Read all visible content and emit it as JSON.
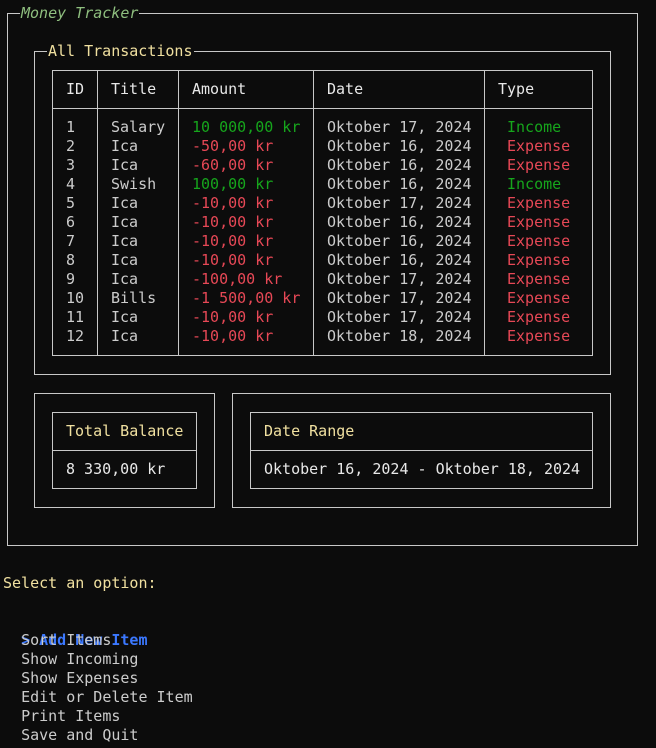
{
  "app": {
    "title": "Money Tracker"
  },
  "transactions": {
    "legend": "All Transactions",
    "columns": [
      "ID",
      "Title",
      "Amount",
      "Date",
      "Type"
    ],
    "rows": [
      {
        "id": "1",
        "title": "Salary",
        "amount": "10 000,00 kr",
        "date": "Oktober 17, 2024",
        "type": "Income"
      },
      {
        "id": "2",
        "title": "Ica",
        "amount": "-50,00 kr",
        "date": "Oktober 16, 2024",
        "type": "Expense"
      },
      {
        "id": "3",
        "title": "Ica",
        "amount": "-60,00 kr",
        "date": "Oktober 16, 2024",
        "type": "Expense"
      },
      {
        "id": "4",
        "title": "Swish",
        "amount": "100,00 kr",
        "date": "Oktober 16, 2024",
        "type": "Income"
      },
      {
        "id": "5",
        "title": "Ica",
        "amount": "-10,00 kr",
        "date": "Oktober 17, 2024",
        "type": "Expense"
      },
      {
        "id": "6",
        "title": "Ica",
        "amount": "-10,00 kr",
        "date": "Oktober 16, 2024",
        "type": "Expense"
      },
      {
        "id": "7",
        "title": "Ica",
        "amount": "-10,00 kr",
        "date": "Oktober 16, 2024",
        "type": "Expense"
      },
      {
        "id": "8",
        "title": "Ica",
        "amount": "-10,00 kr",
        "date": "Oktober 16, 2024",
        "type": "Expense"
      },
      {
        "id": "9",
        "title": "Ica",
        "amount": "-100,00 kr",
        "date": "Oktober 17, 2024",
        "type": "Expense"
      },
      {
        "id": "10",
        "title": "Bills",
        "amount": "-1 500,00 kr",
        "date": "Oktober 17, 2024",
        "type": "Expense"
      },
      {
        "id": "11",
        "title": "Ica",
        "amount": "-10,00 kr",
        "date": "Oktober 17, 2024",
        "type": "Expense"
      },
      {
        "id": "12",
        "title": "Ica",
        "amount": "-10,00 kr",
        "date": "Oktober 18, 2024",
        "type": "Expense"
      }
    ]
  },
  "balance": {
    "label": "Total Balance",
    "value": "8 330,00 kr"
  },
  "date_range": {
    "label": "Date Range",
    "value": "Oktober 16, 2024 - Oktober 18, 2024"
  },
  "menu": {
    "prompt": "Select an option:",
    "cursor": ">",
    "selected_index": 0,
    "options": [
      "Add New Item",
      "Sort Items",
      "Show Incoming",
      "Show Expenses",
      "Edit or Delete Item",
      "Print Items",
      "Save and Quit"
    ]
  },
  "colors": {
    "background": "#0c0c0c",
    "income": "#16a51c",
    "expense": "#e74856",
    "header_yellow": "#f0e0a0",
    "selected": "#3b78ff",
    "title_green": "#8fbf7f"
  }
}
